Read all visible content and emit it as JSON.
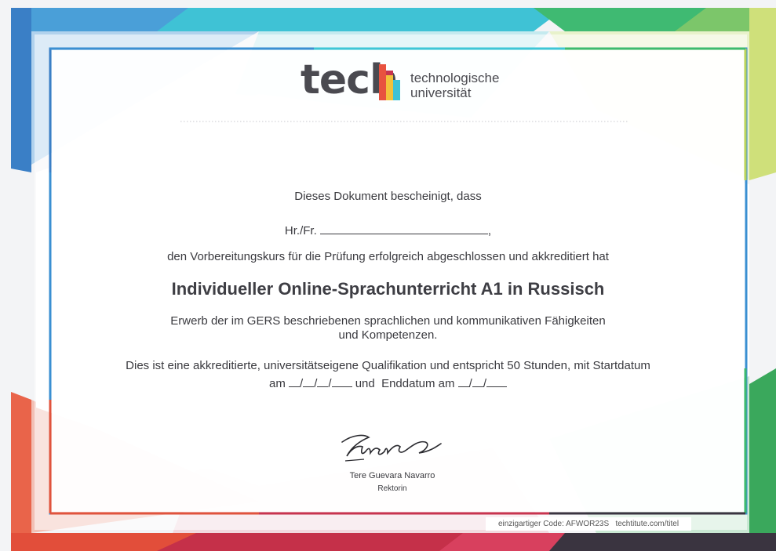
{
  "logo": {
    "wordmark": "tech",
    "line1": "technologische",
    "line2": "universität"
  },
  "certificate": {
    "intro": "Dieses Dokument bescheinigt, dass",
    "name_prefix": "Hr./Fr.",
    "name_suffix": ",",
    "completion": "den Vorbereitungskurs für die Prüfung erfolgreich abgeschlossen und akkreditiert hat",
    "course_title": "Individueller Online-Sprachunterricht A1 in Russisch",
    "description_line1": "Erwerb der im GERS beschriebenen sprachlichen und kommunikativen Fähigkeiten",
    "description_line2": "und Kompetenzen.",
    "accreditation_line1": "Dies ist eine akkreditierte, universitätseigene Qualifikation und entspricht 50 Stunden, mit Startdatum",
    "date_start_prefix": "am",
    "date_and": "und",
    "date_end_prefix": "Enddatum am"
  },
  "signature": {
    "name": "Tere Guevara Navarro",
    "role": "Rektorin"
  },
  "footer": {
    "code_label": "einzigartiger Code: AFWOR23S",
    "url": "techtitute.com/titel"
  },
  "colors": {
    "blue": "#3d8fd4",
    "teal": "#3fc6d6",
    "green": "#3dba6f",
    "lime": "#c8dc6a",
    "red": "#e0533d",
    "magenta": "#c8344f",
    "dark": "#3a3440"
  }
}
